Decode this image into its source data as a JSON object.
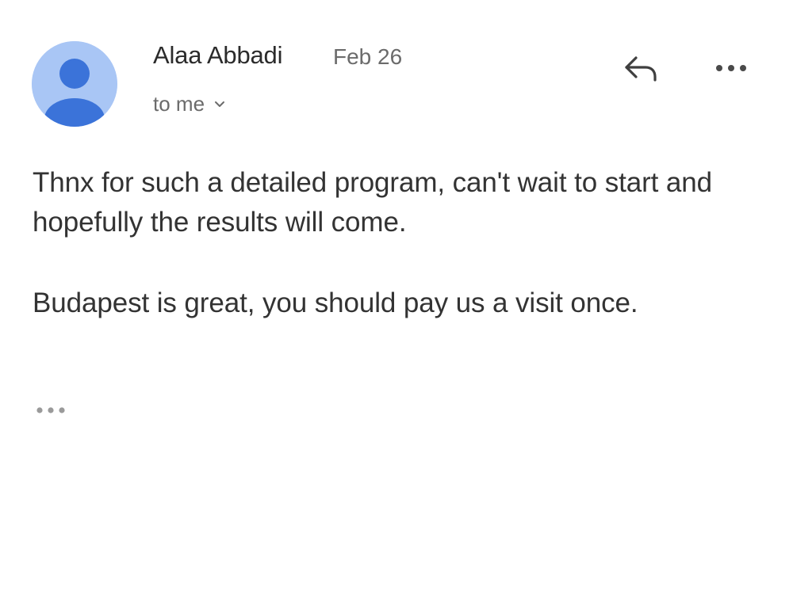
{
  "email": {
    "sender": {
      "name": "Alaa Abbadi",
      "avatar_icon": "person-avatar-icon",
      "avatar_background": "#a9c6f5",
      "avatar_figure_color": "#3b73d9"
    },
    "date": "Feb 26",
    "recipient_label": "to me",
    "actions": {
      "reply_icon": "reply-arrow-icon",
      "more_icon": "more-horizontal-icon",
      "expand_icon": "chevron-down-icon"
    },
    "body": {
      "paragraphs": [
        "Thnx for such a detailed program, can't wait to start and hopefully the results will come.",
        "Budapest is great, you should pay us a visit once."
      ]
    },
    "trimmed_content_icon": "more-horizontal-icon"
  }
}
